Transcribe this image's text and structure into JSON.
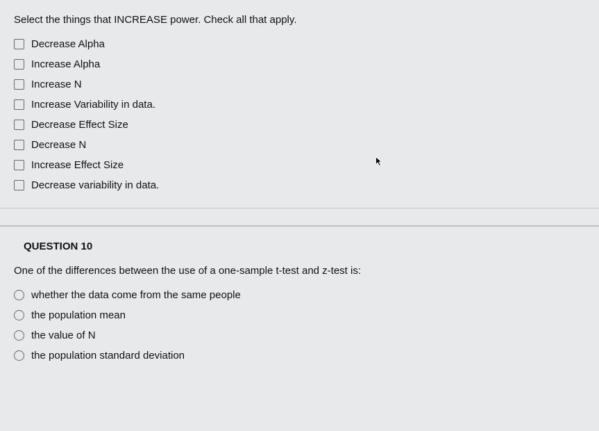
{
  "q9": {
    "prompt": "Select the things that INCREASE power. Check all that apply.",
    "options": [
      "Decrease Alpha",
      "Increase Alpha",
      "Increase N",
      "Increase Variability in data.",
      "Decrease Effect Size",
      "Decrease N",
      "Increase Effect Size",
      "Decrease variability in data."
    ]
  },
  "q10": {
    "heading": "QUESTION 10",
    "prompt": "One of the differences between the use of a one-sample t-test and z-test is:",
    "options": [
      "whether the data come from the same people",
      "the population mean",
      "the value of N",
      "the population standard deviation"
    ]
  }
}
